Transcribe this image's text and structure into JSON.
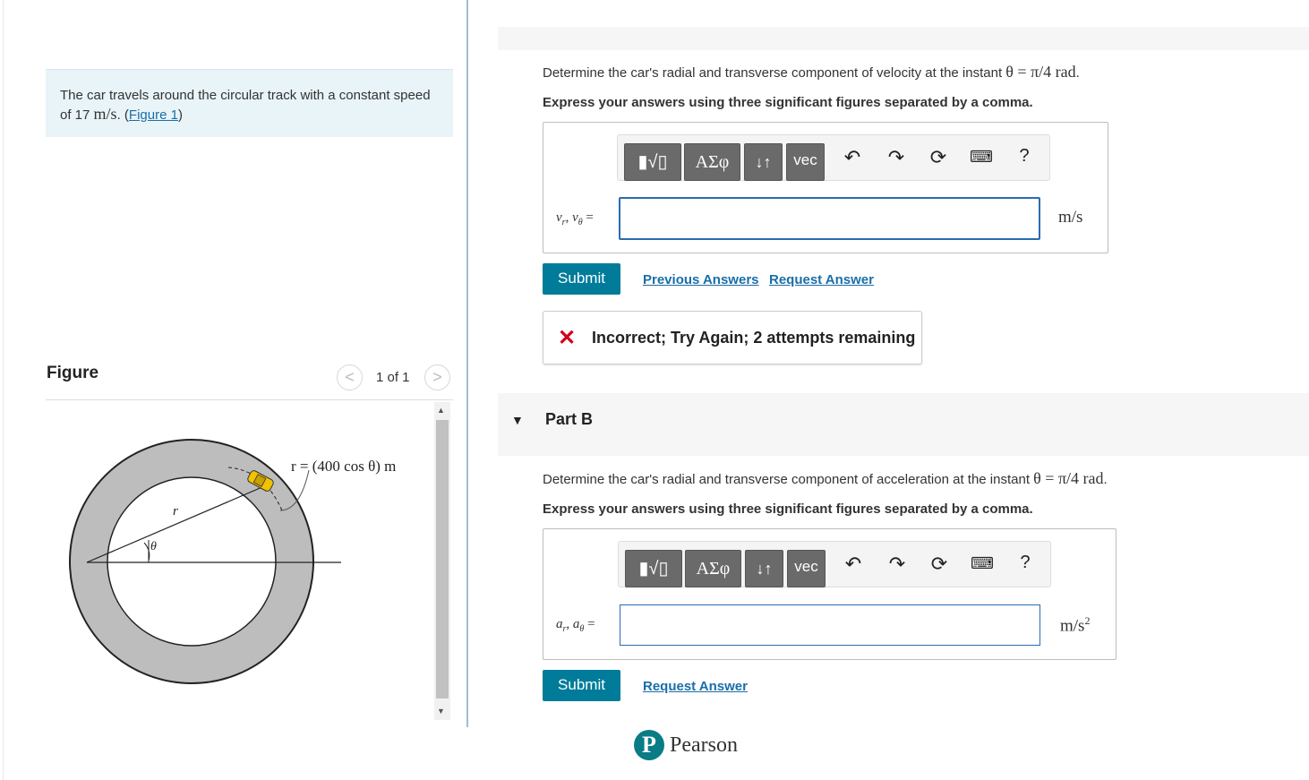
{
  "problem": {
    "text_pre": "The car travels around the circular track with a constant speed of 17",
    "unit": "m/s",
    "text_mid": ". (",
    "figure_link": "Figure 1",
    "text_post": ")"
  },
  "figure": {
    "title": "Figure",
    "prev_symbol": "<",
    "next_symbol": ">",
    "counter": "1 of 1",
    "formula": "r = (400 cos θ) m",
    "r_label": "r",
    "theta_label": "θ"
  },
  "partA": {
    "question_pre": "Determine the car's radial and transverse component of velocity at the instant ",
    "question_math": "θ = π/4 rad",
    "question_post": ".",
    "instruction": "Express your answers using three significant figures separated by a comma.",
    "toolbar": {
      "templates": "▮√▯",
      "greek": "ΑΣφ",
      "updown": "↓↑",
      "vec": "vec",
      "help": "?"
    },
    "label": "v_r, v_θ =",
    "label_html_a": "v",
    "label_sub_a": "r",
    "label_sep": ", ",
    "label_html_b": "v",
    "label_sub_b": "θ",
    "label_eq": " =",
    "unit": "m/s",
    "submit": "Submit",
    "prev_answers": "Previous Answers",
    "request_answer": "Request Answer",
    "feedback_icon": "✕",
    "feedback": "Incorrect; Try Again; 2 attempts remaining"
  },
  "partB": {
    "toggle": "▼",
    "title": "Part B",
    "question_pre": "Determine the car's radial and transverse component of acceleration at the instant ",
    "question_math": "θ = π/4 rad",
    "question_post": ".",
    "instruction": "Express your answers using three significant figures separated by a comma.",
    "toolbar": {
      "templates": "▮√▯",
      "greek": "ΑΣφ",
      "updown": "↓↑",
      "vec": "vec",
      "help": "?"
    },
    "label_a": "a",
    "label_sub_a": "r",
    "label_sep": ", ",
    "label_b": "a",
    "label_sub_b": "θ",
    "label_eq": " =",
    "unit": "m/s",
    "unit_sup": "2",
    "submit": "Submit",
    "request_answer": "Request Answer"
  },
  "footer": {
    "logo_letter": "P",
    "brand": "Pearson"
  },
  "colors": {
    "accent": "#007c9a",
    "link": "#1a6ea8",
    "error": "#d0021b",
    "input_border": "#2b6cb0"
  }
}
